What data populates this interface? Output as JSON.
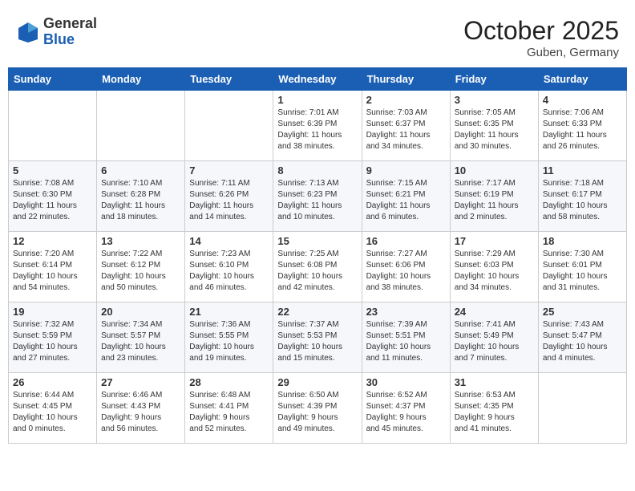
{
  "header": {
    "logo_general": "General",
    "logo_blue": "Blue",
    "month": "October 2025",
    "location": "Guben, Germany"
  },
  "weekdays": [
    "Sunday",
    "Monday",
    "Tuesday",
    "Wednesday",
    "Thursday",
    "Friday",
    "Saturday"
  ],
  "weeks": [
    [
      {
        "day": "",
        "info": ""
      },
      {
        "day": "",
        "info": ""
      },
      {
        "day": "",
        "info": ""
      },
      {
        "day": "1",
        "info": "Sunrise: 7:01 AM\nSunset: 6:39 PM\nDaylight: 11 hours\nand 38 minutes."
      },
      {
        "day": "2",
        "info": "Sunrise: 7:03 AM\nSunset: 6:37 PM\nDaylight: 11 hours\nand 34 minutes."
      },
      {
        "day": "3",
        "info": "Sunrise: 7:05 AM\nSunset: 6:35 PM\nDaylight: 11 hours\nand 30 minutes."
      },
      {
        "day": "4",
        "info": "Sunrise: 7:06 AM\nSunset: 6:33 PM\nDaylight: 11 hours\nand 26 minutes."
      }
    ],
    [
      {
        "day": "5",
        "info": "Sunrise: 7:08 AM\nSunset: 6:30 PM\nDaylight: 11 hours\nand 22 minutes."
      },
      {
        "day": "6",
        "info": "Sunrise: 7:10 AM\nSunset: 6:28 PM\nDaylight: 11 hours\nand 18 minutes."
      },
      {
        "day": "7",
        "info": "Sunrise: 7:11 AM\nSunset: 6:26 PM\nDaylight: 11 hours\nand 14 minutes."
      },
      {
        "day": "8",
        "info": "Sunrise: 7:13 AM\nSunset: 6:23 PM\nDaylight: 11 hours\nand 10 minutes."
      },
      {
        "day": "9",
        "info": "Sunrise: 7:15 AM\nSunset: 6:21 PM\nDaylight: 11 hours\nand 6 minutes."
      },
      {
        "day": "10",
        "info": "Sunrise: 7:17 AM\nSunset: 6:19 PM\nDaylight: 11 hours\nand 2 minutes."
      },
      {
        "day": "11",
        "info": "Sunrise: 7:18 AM\nSunset: 6:17 PM\nDaylight: 10 hours\nand 58 minutes."
      }
    ],
    [
      {
        "day": "12",
        "info": "Sunrise: 7:20 AM\nSunset: 6:14 PM\nDaylight: 10 hours\nand 54 minutes."
      },
      {
        "day": "13",
        "info": "Sunrise: 7:22 AM\nSunset: 6:12 PM\nDaylight: 10 hours\nand 50 minutes."
      },
      {
        "day": "14",
        "info": "Sunrise: 7:23 AM\nSunset: 6:10 PM\nDaylight: 10 hours\nand 46 minutes."
      },
      {
        "day": "15",
        "info": "Sunrise: 7:25 AM\nSunset: 6:08 PM\nDaylight: 10 hours\nand 42 minutes."
      },
      {
        "day": "16",
        "info": "Sunrise: 7:27 AM\nSunset: 6:06 PM\nDaylight: 10 hours\nand 38 minutes."
      },
      {
        "day": "17",
        "info": "Sunrise: 7:29 AM\nSunset: 6:03 PM\nDaylight: 10 hours\nand 34 minutes."
      },
      {
        "day": "18",
        "info": "Sunrise: 7:30 AM\nSunset: 6:01 PM\nDaylight: 10 hours\nand 31 minutes."
      }
    ],
    [
      {
        "day": "19",
        "info": "Sunrise: 7:32 AM\nSunset: 5:59 PM\nDaylight: 10 hours\nand 27 minutes."
      },
      {
        "day": "20",
        "info": "Sunrise: 7:34 AM\nSunset: 5:57 PM\nDaylight: 10 hours\nand 23 minutes."
      },
      {
        "day": "21",
        "info": "Sunrise: 7:36 AM\nSunset: 5:55 PM\nDaylight: 10 hours\nand 19 minutes."
      },
      {
        "day": "22",
        "info": "Sunrise: 7:37 AM\nSunset: 5:53 PM\nDaylight: 10 hours\nand 15 minutes."
      },
      {
        "day": "23",
        "info": "Sunrise: 7:39 AM\nSunset: 5:51 PM\nDaylight: 10 hours\nand 11 minutes."
      },
      {
        "day": "24",
        "info": "Sunrise: 7:41 AM\nSunset: 5:49 PM\nDaylight: 10 hours\nand 7 minutes."
      },
      {
        "day": "25",
        "info": "Sunrise: 7:43 AM\nSunset: 5:47 PM\nDaylight: 10 hours\nand 4 minutes."
      }
    ],
    [
      {
        "day": "26",
        "info": "Sunrise: 6:44 AM\nSunset: 4:45 PM\nDaylight: 10 hours\nand 0 minutes."
      },
      {
        "day": "27",
        "info": "Sunrise: 6:46 AM\nSunset: 4:43 PM\nDaylight: 9 hours\nand 56 minutes."
      },
      {
        "day": "28",
        "info": "Sunrise: 6:48 AM\nSunset: 4:41 PM\nDaylight: 9 hours\nand 52 minutes."
      },
      {
        "day": "29",
        "info": "Sunrise: 6:50 AM\nSunset: 4:39 PM\nDaylight: 9 hours\nand 49 minutes."
      },
      {
        "day": "30",
        "info": "Sunrise: 6:52 AM\nSunset: 4:37 PM\nDaylight: 9 hours\nand 45 minutes."
      },
      {
        "day": "31",
        "info": "Sunrise: 6:53 AM\nSunset: 4:35 PM\nDaylight: 9 hours\nand 41 minutes."
      },
      {
        "day": "",
        "info": ""
      }
    ]
  ]
}
